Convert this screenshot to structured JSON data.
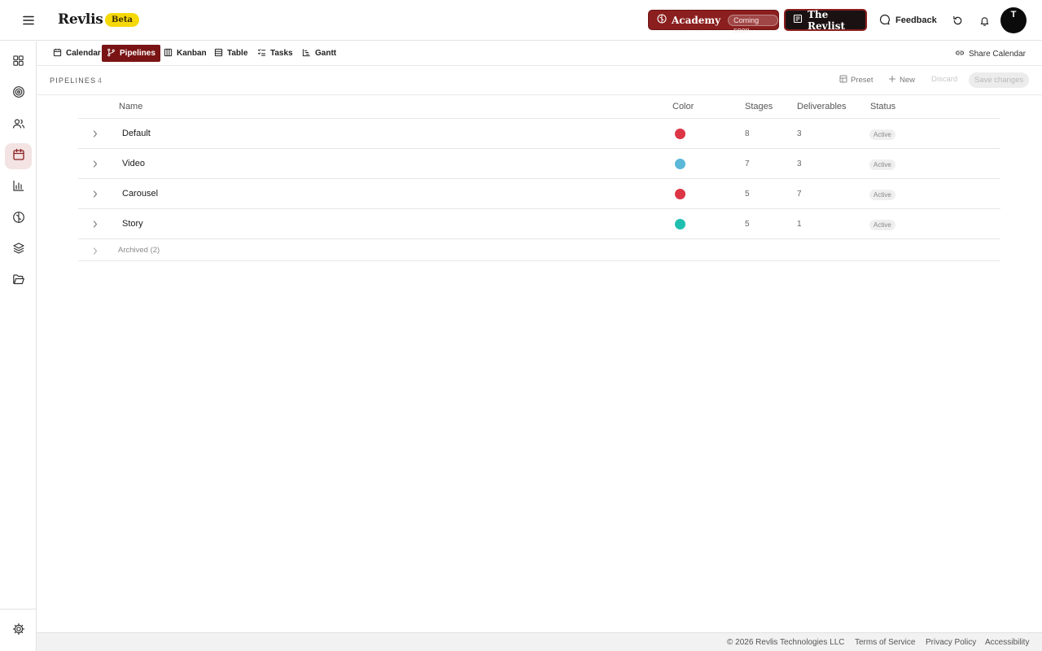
{
  "header": {
    "brand": "Revlis",
    "beta_label": "Beta",
    "academy_label": "Academy",
    "academy_badge": "Coming soon",
    "revlist_label": "The Revlist",
    "feedback_label": "Feedback",
    "avatar_initial": "T",
    "colors": {
      "academy_bg": "#8b1e1e",
      "revlist_bg": "#1a1212",
      "beta_bg": "#f5d90a"
    }
  },
  "sidebar": {
    "items": [
      {
        "icon": "grid-icon"
      },
      {
        "icon": "target-icon"
      },
      {
        "icon": "users-icon"
      },
      {
        "icon": "calendar-icon",
        "active": true
      },
      {
        "icon": "bar-chart-icon"
      },
      {
        "icon": "brain-icon"
      },
      {
        "icon": "layers-icon"
      },
      {
        "icon": "folder-icon"
      }
    ],
    "bottom_icon": "settings-icon"
  },
  "tabs": {
    "items": [
      {
        "label": "Calendar",
        "icon": "calendar-icon"
      },
      {
        "label": "Pipelines",
        "icon": "branch-icon",
        "active": true
      },
      {
        "label": "Kanban",
        "icon": "kanban-icon"
      },
      {
        "label": "Table",
        "icon": "table-icon"
      },
      {
        "label": "Tasks",
        "icon": "checklist-icon"
      },
      {
        "label": "Gantt",
        "icon": "gantt-icon"
      }
    ],
    "share_label": "Share Calendar",
    "active_color": "#7a1414"
  },
  "toolbar": {
    "title": "PIPELINES",
    "count": "4",
    "preset_label": "Preset",
    "new_label": "New",
    "discard_label": "Discard",
    "save_label": "Save changes"
  },
  "table": {
    "headers": {
      "name": "Name",
      "color": "Color",
      "stages": "Stages",
      "deliverables": "Deliverables",
      "status": "Status"
    },
    "rows": [
      {
        "name": "Default",
        "color": "#dc3545",
        "stages": "8",
        "deliverables": "3",
        "status": "Active"
      },
      {
        "name": "Video",
        "color": "#5ab8d8",
        "stages": "7",
        "deliverables": "3",
        "status": "Active"
      },
      {
        "name": "Carousel",
        "color": "#dc3545",
        "stages": "5",
        "deliverables": "7",
        "status": "Active"
      },
      {
        "name": "Story",
        "color": "#1fbfb0",
        "stages": "5",
        "deliverables": "1",
        "status": "Active"
      }
    ],
    "archived_label": "Archived (2)"
  },
  "footer": {
    "copyright": "© 2026 Revlis Technologies LLC",
    "terms": "Terms of Service",
    "privacy": "Privacy Policy",
    "accessibility": "Accessibility"
  }
}
